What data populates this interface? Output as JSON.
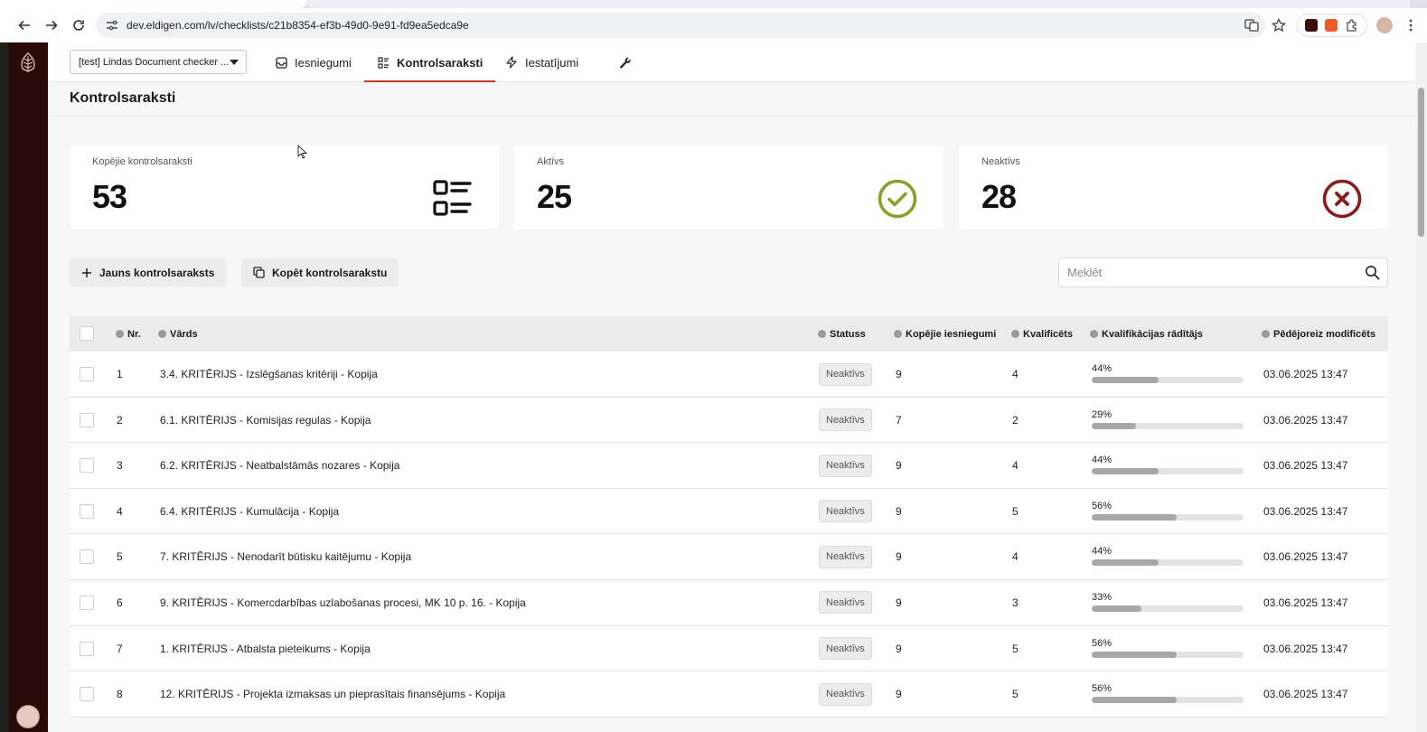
{
  "browser": {
    "url": "dev.eldigen.com/lv/checklists/c21b8354-ef3b-49d0-9e91-fd9ea5edca9e"
  },
  "topnav": {
    "org_select": "[test] Lindas Document checker ...",
    "tabs": [
      {
        "label": "Iesniegumi",
        "icon": "inbox-icon"
      },
      {
        "label": "Kontrolsaraksti",
        "icon": "checklist-icon",
        "active": true
      },
      {
        "label": "Iestatījumi",
        "icon": "bolt-icon"
      }
    ],
    "tools_icon": "wrench-icon"
  },
  "page": {
    "title": "Kontrolsaraksti"
  },
  "cards": [
    {
      "label": "Kopējie kontrolsaraksti",
      "value": "53",
      "icon": "list-icon"
    },
    {
      "label": "Aktīvs",
      "value": "25",
      "icon": "check-circle-icon",
      "color": "#8aa02a"
    },
    {
      "label": "Neaktīvs",
      "value": "28",
      "icon": "x-circle-icon",
      "color": "#8b1a1a"
    }
  ],
  "actions": {
    "new_label": "Jauns kontrolsaraksts",
    "copy_label": "Kopēt kontrolsarakstu",
    "search_placeholder": "Meklēt"
  },
  "table": {
    "headers": {
      "nr": "Nr.",
      "name": "Vārds",
      "status": "Statuss",
      "total": "Kopējie iesniegumi",
      "qualified": "Kvalificēts",
      "rate": "Kvalifikācijas rādītājs",
      "modified": "Pēdējoreiz modificēts"
    },
    "rows": [
      {
        "nr": "1",
        "name": "3.4. KRITĒRIJS - Izslēgšanas kritēriji - Kopija",
        "status": "Neaktīvs",
        "total": "9",
        "qualified": "4",
        "rate_label": "44%",
        "rate": 0.44,
        "modified": "03.06.2025 13:47"
      },
      {
        "nr": "2",
        "name": "6.1. KRITĒRIJS - Komisijas regulas - Kopija",
        "status": "Neaktīvs",
        "total": "7",
        "qualified": "2",
        "rate_label": "29%",
        "rate": 0.29,
        "modified": "03.06.2025 13:47"
      },
      {
        "nr": "3",
        "name": "6.2. KRITĒRIJS - Neatbalstāmās nozares - Kopija",
        "status": "Neaktīvs",
        "total": "9",
        "qualified": "4",
        "rate_label": "44%",
        "rate": 0.44,
        "modified": "03.06.2025 13:47"
      },
      {
        "nr": "4",
        "name": "6.4. KRITĒRIJS - Kumulācija - Kopija",
        "status": "Neaktīvs",
        "total": "9",
        "qualified": "5",
        "rate_label": "56%",
        "rate": 0.56,
        "modified": "03.06.2025 13:47"
      },
      {
        "nr": "5",
        "name": "7. KRITĒRIJS - Nenodarīt būtisku kaitējumu - Kopija",
        "status": "Neaktīvs",
        "total": "9",
        "qualified": "4",
        "rate_label": "44%",
        "rate": 0.44,
        "modified": "03.06.2025 13:47"
      },
      {
        "nr": "6",
        "name": "9. KRITĒRIJS - Komercdarbības uzlabošanas procesi, MK 10 p. 16. - Kopija",
        "status": "Neaktīvs",
        "total": "9",
        "qualified": "3",
        "rate_label": "33%",
        "rate": 0.33,
        "modified": "03.06.2025 13:47"
      },
      {
        "nr": "7",
        "name": "1. KRITĒRIJS - Atbalsta pieteikums - Kopija",
        "status": "Neaktīvs",
        "total": "9",
        "qualified": "5",
        "rate_label": "56%",
        "rate": 0.56,
        "modified": "03.06.2025 13:47"
      },
      {
        "nr": "8",
        "name": "12. KRITĒRIJS - Projekta izmaksas un pieprasītais finansējums - Kopija",
        "status": "Neaktīvs",
        "total": "9",
        "qualified": "5",
        "rate_label": "56%",
        "rate": 0.56,
        "modified": "03.06.2025 13:47"
      }
    ]
  }
}
